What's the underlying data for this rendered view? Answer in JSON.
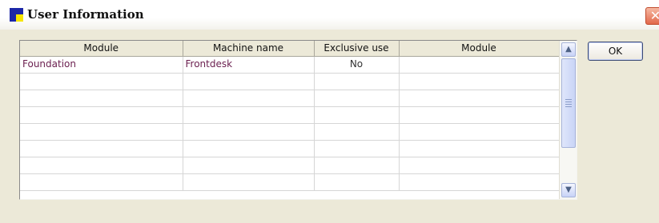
{
  "window": {
    "title": "User Information",
    "close_glyph": "✕",
    "app_icon": "app-icon",
    "close_icon": "close-icon"
  },
  "grid": {
    "columns": [
      "Module",
      "Machine name",
      "Exclusive use",
      "Module"
    ],
    "rows": [
      [
        "Foundation",
        "Frontdesk",
        "No",
        ""
      ],
      [
        "",
        "",
        "",
        ""
      ],
      [
        "",
        "",
        "",
        ""
      ],
      [
        "",
        "",
        "",
        ""
      ],
      [
        "",
        "",
        "",
        ""
      ],
      [
        "",
        "",
        "",
        ""
      ],
      [
        "",
        "",
        "",
        ""
      ],
      [
        "",
        "",
        "",
        ""
      ]
    ]
  },
  "scrollbar": {
    "up_glyph": "▲",
    "down_glyph": "▼"
  },
  "buttons": {
    "ok_label": "OK"
  },
  "colors": {
    "window_bg": "#ece9d8",
    "cell_text": "#6a1e4e",
    "icon_blue": "#1c27a8",
    "icon_yellow": "#f6e600"
  }
}
